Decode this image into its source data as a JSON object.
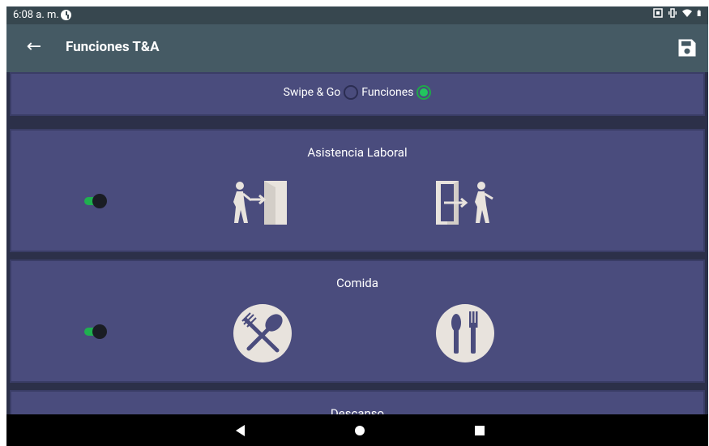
{
  "status_bar": {
    "time": "6:08 a. m."
  },
  "app_bar": {
    "title": "Funciones T&A"
  },
  "mode_selector": {
    "option_1_label": "Swipe & Go",
    "option_1_selected": false,
    "option_2_label": "Funciones",
    "option_2_selected": true
  },
  "sections": [
    {
      "title": "Asistencia Laboral",
      "enabled": true,
      "icons": [
        "entry-door-icon",
        "exit-door-icon"
      ]
    },
    {
      "title": "Comida",
      "enabled": true,
      "icons": [
        "fork-spoon-crossed-icon",
        "fork-knife-icon"
      ]
    },
    {
      "title": "Descanso"
    }
  ],
  "colors": {
    "card": "#4a4c7d",
    "accent_green": "#22c55e",
    "app_bar": "#455a64",
    "status_bar": "#37474f"
  }
}
